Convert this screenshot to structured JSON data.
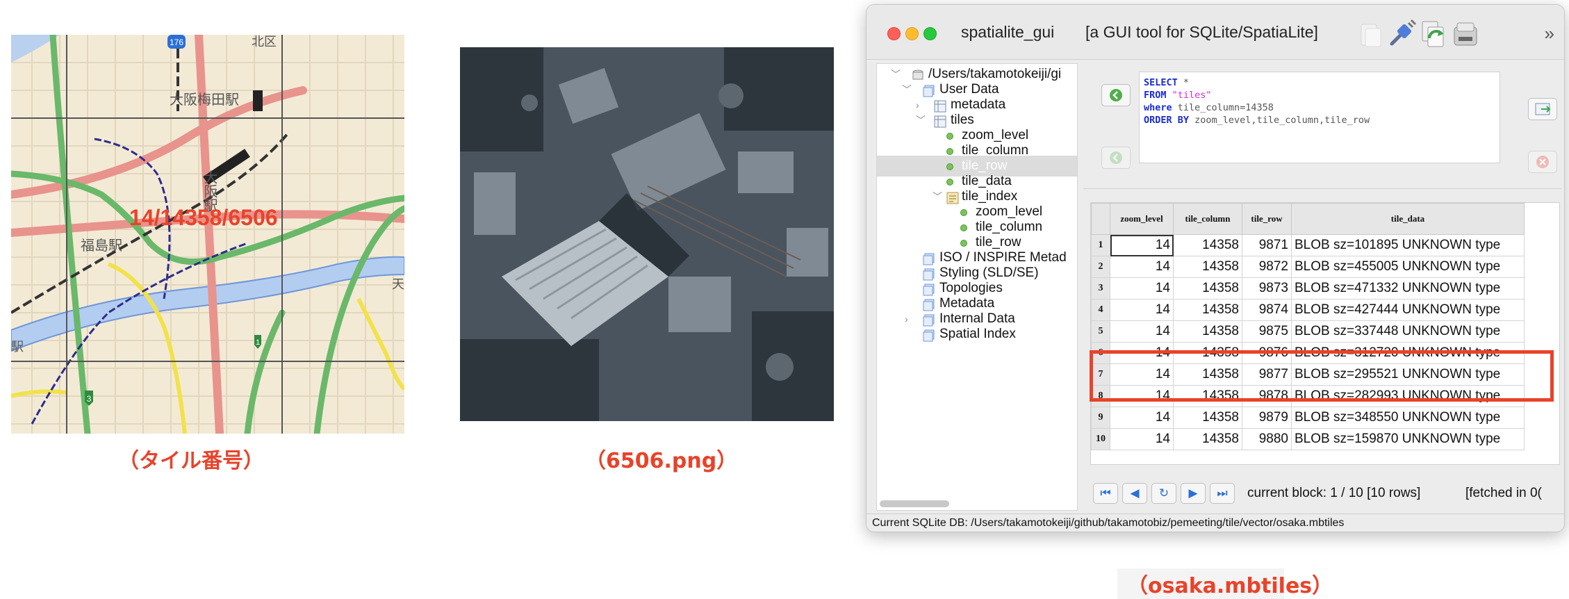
{
  "captions": {
    "tile_number": "（タイル番号）",
    "png": "（6506.png）",
    "mbtiles": "（osaka.mbtiles）"
  },
  "map": {
    "tile_label": "14/14358/6506",
    "station_umeda": "大阪梅田駅",
    "station_osaka": "大阪駅",
    "station_fukushima": "福島駅",
    "route_176": "176",
    "marker_1": "1",
    "marker_3": "3",
    "edge_eki": "駅",
    "edge_ten": "天",
    "top_text": "北区"
  },
  "window": {
    "app_name": "spatialite_gui",
    "subtitle": "[a GUI tool for SQLite/SpatiaLite]",
    "overflow": "»"
  },
  "tree": {
    "root": "/Users/takamotokeiji/gi",
    "items": [
      {
        "label": "User Data"
      },
      {
        "label": "metadata"
      },
      {
        "label": "tiles"
      },
      {
        "label": "zoom_level"
      },
      {
        "label": "tile_column"
      },
      {
        "label": "tile_row"
      },
      {
        "label": "tile_data"
      },
      {
        "label": "tile_index"
      },
      {
        "label": "zoom_level"
      },
      {
        "label": "tile_column"
      },
      {
        "label": "tile_row"
      },
      {
        "label": "ISO / INSPIRE Metad"
      },
      {
        "label": "Styling (SLD/SE)"
      },
      {
        "label": "Topologies"
      },
      {
        "label": "Metadata"
      },
      {
        "label": "Internal Data"
      },
      {
        "label": "Spatial Index"
      }
    ]
  },
  "sql": {
    "select": "SELECT",
    "star": " *",
    "from": "FROM",
    "table": " \"tiles\"",
    "where": "where",
    "cond": " tile_column=14358",
    "order": "ORDER BY",
    "order_cols": " zoom_level,tile_column,tile_row"
  },
  "grid": {
    "columns": [
      "zoom_level",
      "tile_column",
      "tile_row",
      "tile_data"
    ],
    "rows": [
      {
        "n": "1",
        "z": "14",
        "c": "14358",
        "r": "9871",
        "d": "BLOB sz=101895 UNKNOWN type"
      },
      {
        "n": "2",
        "z": "14",
        "c": "14358",
        "r": "9872",
        "d": "BLOB sz=455005 UNKNOWN type"
      },
      {
        "n": "3",
        "z": "14",
        "c": "14358",
        "r": "9873",
        "d": "BLOB sz=471332 UNKNOWN type"
      },
      {
        "n": "4",
        "z": "14",
        "c": "14358",
        "r": "9874",
        "d": "BLOB sz=427444 UNKNOWN type"
      },
      {
        "n": "5",
        "z": "14",
        "c": "14358",
        "r": "9875",
        "d": "BLOB sz=337448 UNKNOWN type"
      },
      {
        "n": "6",
        "z": "14",
        "c": "14358",
        "r": "9876",
        "d": "BLOB sz=312720 UNKNOWN type"
      },
      {
        "n": "7",
        "z": "14",
        "c": "14358",
        "r": "9877",
        "d": "BLOB sz=295521 UNKNOWN type"
      },
      {
        "n": "8",
        "z": "14",
        "c": "14358",
        "r": "9878",
        "d": "BLOB sz=282993 UNKNOWN type"
      },
      {
        "n": "9",
        "z": "14",
        "c": "14358",
        "r": "9879",
        "d": "BLOB sz=348550 UNKNOWN type"
      },
      {
        "n": "10",
        "z": "14",
        "c": "14358",
        "r": "9880",
        "d": "BLOB sz=159870 UNKNOWN type"
      }
    ]
  },
  "nav": {
    "block": "current block: 1 / 10 [10 rows]",
    "fetched": "[fetched in 0("
  },
  "status": {
    "db": "Current SQLite DB: /Users/takamotokeiji/github/takamotobiz/pemeeting/tile/vector/osaka.mbtiles"
  },
  "colors": {
    "highlight": "#e8432a",
    "sql_keyword": "#1a2bd6",
    "sql_string": "#d92ad9"
  }
}
